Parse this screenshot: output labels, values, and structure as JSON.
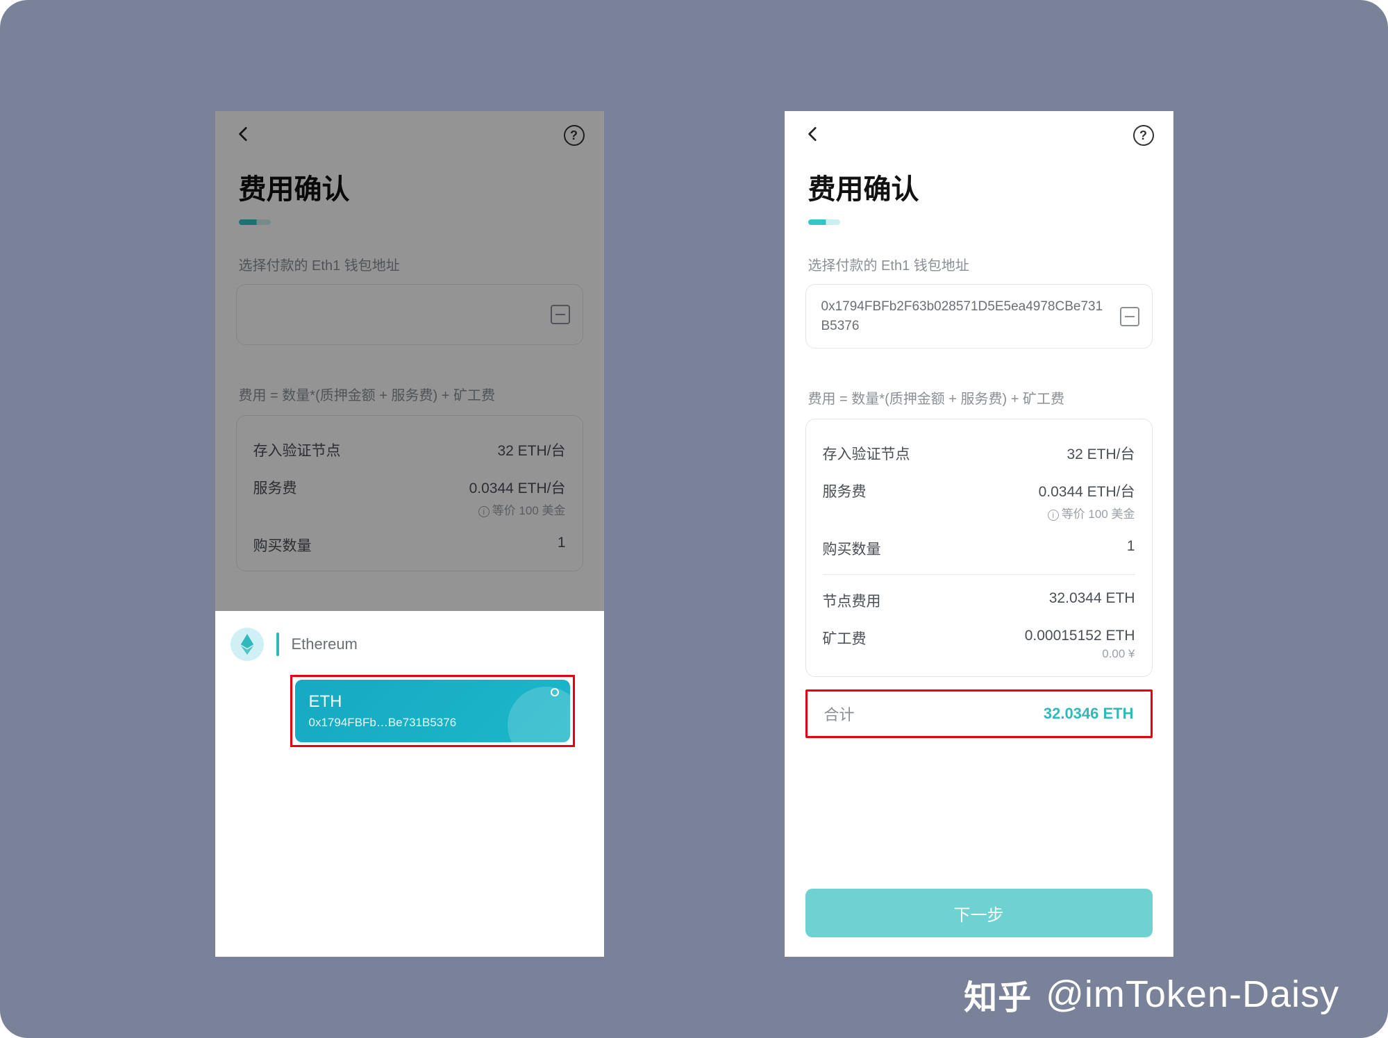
{
  "watermark": {
    "brand": "知乎",
    "author": "@imToken-Daisy"
  },
  "shared": {
    "title": "费用确认",
    "sublabel": "选择付款的 Eth1 钱包地址",
    "formula": "费用 = 数量*(质押金额 + 服务费) + 矿工费",
    "rows": {
      "deposit_label": "存入验证节点",
      "deposit_value": "32 ETH/台",
      "service_label": "服务费",
      "service_value": "0.0344 ETH/台",
      "service_sub": "等价 100 美金",
      "qty_label": "购买数量",
      "qty_value": "1"
    }
  },
  "left": {
    "wallet_label": "Ethereum",
    "wallet_name": "ETH",
    "wallet_addr_short": "0x1794FBFb…Be731B5376"
  },
  "right": {
    "address": "0x1794FBFb2F63b028571D5E5ea4978CBe731B5376",
    "node_fee_label": "节点费用",
    "node_fee_value": "32.0344 ETH",
    "miner_fee_label": "矿工费",
    "miner_fee_value": "0.00015152 ETH",
    "miner_fee_sub": "0.00 ¥",
    "total_label": "合计",
    "total_value": "32.0346 ETH",
    "next": "下一步"
  }
}
